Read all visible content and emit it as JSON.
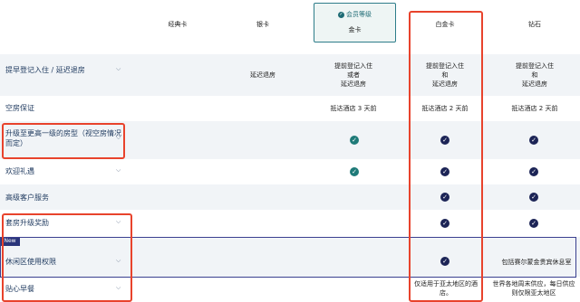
{
  "columns": {
    "classic": "经典卡",
    "silver": "银卡",
    "gold_badge": "会员等级",
    "gold": "金卡",
    "platinum": "白金卡",
    "diamond": "钻石"
  },
  "rows": [
    {
      "label": "提早登记入住 / 延迟退房",
      "silver": "延迟退房",
      "gold": "提前登记入住\n或者\n延迟退房",
      "platinum": "提前登记入住\n和\n延迟退房",
      "diamond": "提前登记入住\n和\n延迟退房"
    },
    {
      "label": "空房保证",
      "gold": "抵达酒店 3 天前",
      "platinum": "抵达酒店 2 天前",
      "diamond": "抵达酒店 2 天前"
    },
    {
      "label": "升级至更高一级的房型（视空房情况而定）"
    },
    {
      "label": "欢迎礼遇"
    },
    {
      "label": "高级客户服务"
    },
    {
      "label": "套房升级奖励"
    },
    {
      "label": "休闲区使用权限",
      "diamond": "包括赛尔蒙金贵宾休息室"
    },
    {
      "label": "贴心早餐",
      "platinum": "仅适用于亚太地区的酒店。",
      "diamond": "世界各地周末供应，每日供应则仅限亚太地区"
    }
  ],
  "new_tag": "New",
  "colors": {
    "teal_check": "#1e7a78",
    "navy_check": "#1c2456",
    "highlight_red": "#e8432c"
  }
}
